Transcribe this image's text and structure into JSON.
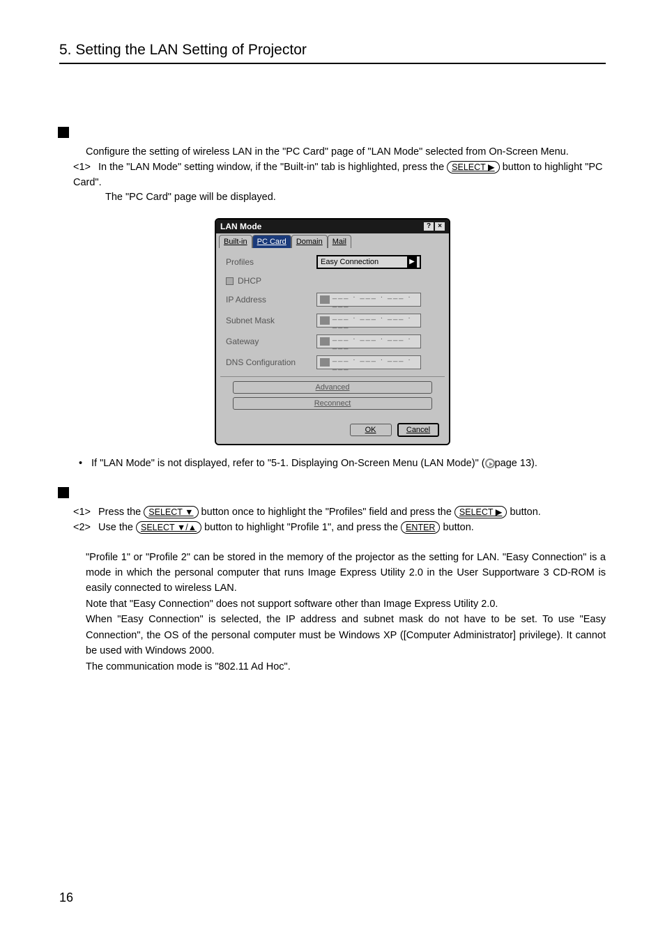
{
  "header": "5. Setting the LAN Setting of Projector",
  "intro": "Configure the setting of wireless LAN in the \"PC Card\" page of \"LAN Mode\" selected from On-Screen Menu.",
  "step1_num": "<1>",
  "step1_a": "In the \"LAN Mode\" setting window, if the \"Built-in\" tab is highlighted, press the ",
  "step1_b": " button to highlight \"PC Card\".",
  "step1_c": "The \"PC Card\" page will be displayed.",
  "btn_select_right": "SELECT ▶",
  "btn_select_down": "SELECT ▼",
  "btn_select_updown": "SELECT ▼/▲",
  "btn_enter": "ENTER",
  "dialog": {
    "title": "LAN Mode",
    "tabs": [
      "Built-in",
      "PC Card",
      "Domain",
      "Mail"
    ],
    "profiles_label": "Profiles",
    "profiles_value": "Easy Connection",
    "dhcp": "DHCP",
    "ip_label": "IP Address",
    "subnet_label": "Subnet Mask",
    "gateway_label": "Gateway",
    "dns_label": "DNS Configuration",
    "ip_dots": "___ . ___ . ___ . ___",
    "advanced": "Advanced",
    "reconnect": "Reconnect",
    "ok": "OK",
    "cancel": "Cancel"
  },
  "bullet1_a": "If \"LAN Mode\" is not displayed, refer to \"5-1. Displaying On-Screen Menu (LAN Mode)\" (",
  "bullet1_b": "page 13).",
  "sec2_step1_num": "<1>",
  "sec2_step1_a": "Press the ",
  "sec2_step1_b": " button once to highlight the \"Profiles\" field and press the ",
  "sec2_step1_c": " button.",
  "sec2_step2_num": "<2>",
  "sec2_step2_a": "Use the ",
  "sec2_step2_b": " button to highlight \"Profile 1\", and press the ",
  "sec2_step2_c": " button.",
  "para": "\"Profile 1\" or \"Profile 2\" can be stored in the memory of the projector as the setting for LAN. \"Easy Connection\" is a mode in which the personal computer that runs Image Express Utility 2.0 in the User Supportware 3 CD-ROM is easily connected to wireless LAN.\nNote that \"Easy Connection\" does not support software other than Image Express Utility 2.0.\nWhen \"Easy Connection\" is selected, the IP address and subnet mask do not have to be set.  To use \"Easy Connection\", the OS of the personal computer must be Windows XP ([Computer Administrator] privilege).  It cannot be used with Windows 2000.\nThe communication mode is \"802.11 Ad Hoc\".",
  "page_number": "16"
}
